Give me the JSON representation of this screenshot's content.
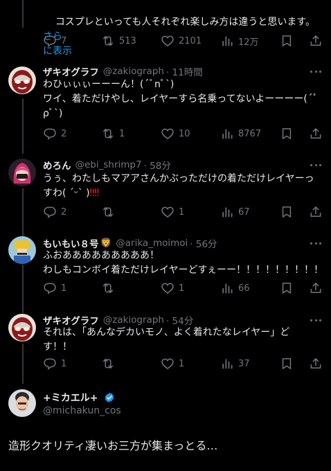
{
  "tweets": [
    {
      "text": "コスプレといっても人それぞれ楽しみ方は違うと思います。",
      "show_more": "さら\nに表示",
      "replies": "7",
      "retweets": "513",
      "likes": "2101",
      "views": "12万"
    },
    {
      "name": "ザキオグラフ",
      "handle": "@zakiograph",
      "time": "· 11時間",
      "text": "わひぃぃぃーーーん！(´ﾟnﾟ`)\nワイ、着ただけやし、レイヤーすら名乗ってないよーーーー(´ﾟ\nρﾟ`)",
      "replies": "2",
      "retweets": "1",
      "likes": "10",
      "views": "8767"
    },
    {
      "name": "めろん",
      "handle": "@ebi_shrimp7",
      "time": "· 58分",
      "text": "うぅ、わたしもマアアさんかぶっただけの着ただけレイヤーっ\nすわ( ˊᵕˋ )",
      "emoji": "‼‼",
      "replies": "2",
      "retweets": "",
      "likes": "1",
      "views": "67"
    },
    {
      "name": "もいもい８号",
      "badge": "🦁",
      "handle": "@arika_moimoi",
      "time": "· 56分",
      "text": "ふおあああああああああ！\nわしもコンボイ着ただけレイヤーどすぇーー！！！！！！！！！",
      "replies": "1",
      "retweets": "",
      "likes": "1",
      "views": "66"
    },
    {
      "name": "ザキオグラフ",
      "handle": "@zakiograph",
      "time": "· 54分",
      "text": "それは、「あんなデカいモノ、よく着れたなレイヤー」ど\nす！！",
      "replies": "1",
      "retweets": "",
      "likes": "1",
      "views": "37"
    }
  ],
  "main": {
    "name": "+ミカエル+",
    "handle": "@michakun_cos",
    "text": "造形クオリティ凄いお三方が集まっとる…"
  },
  "colors": {
    "accent": "#1d9bf0",
    "muted": "#71767b",
    "text": "#e7e9ea",
    "bg": "#000000"
  }
}
